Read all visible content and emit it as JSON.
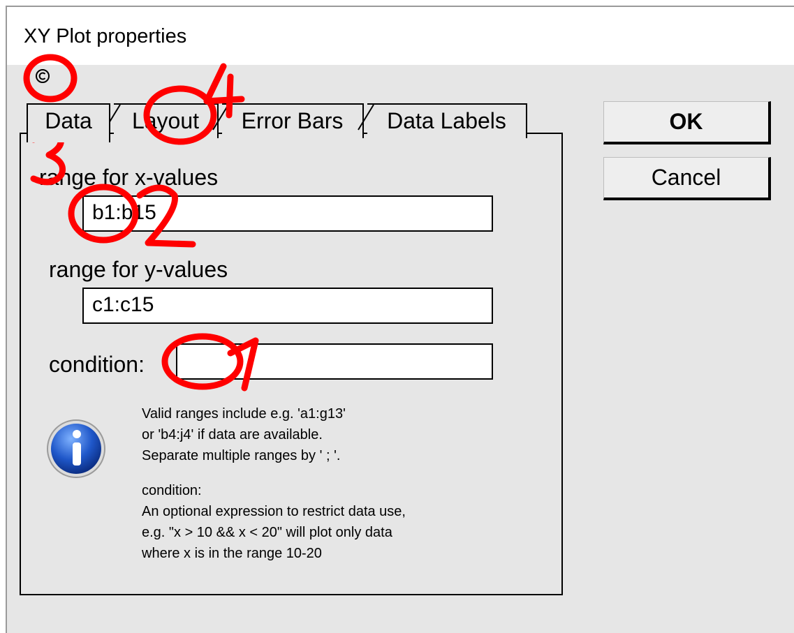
{
  "window": {
    "title": "XY Plot properties"
  },
  "tabs": [
    {
      "label": "Data",
      "active": true
    },
    {
      "label": "Layout",
      "active": false
    },
    {
      "label": "Error Bars",
      "active": false
    },
    {
      "label": "Data Labels",
      "active": false
    }
  ],
  "fields": {
    "x_label": "range for x-values",
    "x_value": "b1:b15",
    "y_label": "range for y-values",
    "y_value": "c1:c15",
    "condition_label": "condition:",
    "condition_value": ""
  },
  "buttons": {
    "ok": "OK",
    "cancel": "Cancel"
  },
  "help": {
    "line1": "Valid ranges include e.g. 'a1:g13'",
    "line2": "or 'b4:j4' if data are available.",
    "line3": "Separate multiple ranges by ' ; '.",
    "line4": "condition:",
    "line5": "An optional expression to restrict data use,",
    "line6": "e.g. \"x > 10 && x < 20\" will plot only data",
    "line7": "where x is in the range 10-20"
  },
  "annotations": {
    "color": "#ff0000",
    "marks": [
      "1",
      "2",
      "3",
      "4"
    ]
  },
  "icons": {
    "copyright": "copyright-icon",
    "info": "info-icon"
  }
}
